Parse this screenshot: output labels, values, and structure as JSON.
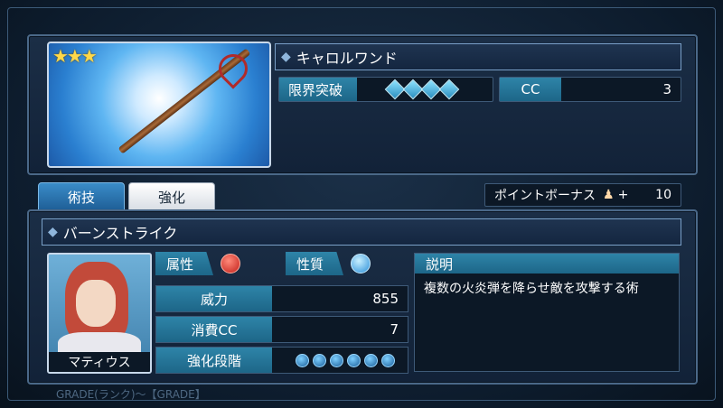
{
  "weapon": {
    "name": "キャロルワンド",
    "stars": "★★★",
    "limit_break_label": "限界突破",
    "limit_break_gems": 4,
    "cc_label": "CC",
    "cc_value": "3"
  },
  "tabs": [
    {
      "label": "術技",
      "active": true
    },
    {
      "label": "強化",
      "active": false
    }
  ],
  "point_bonus": {
    "label": "ポイントボーナス",
    "sign": "+",
    "value": "10"
  },
  "skill": {
    "name": "バーンストライク",
    "attribute_label": "属性",
    "nature_label": "性質",
    "power_label": "威力",
    "power_value": "855",
    "cost_label": "消費CC",
    "cost_value": "7",
    "enhance_label": "強化段階",
    "enhance_dots": 6,
    "description_label": "説明",
    "description": "複数の火炎弾を降らせ敵を攻撃する術"
  },
  "character": {
    "name": "マティウス"
  },
  "footer": "GRADE(ランク)～【GRADE】",
  "colors": {
    "accent": "#2e84a8",
    "fire_orb": "#d8322a",
    "nature_orb": "#3aa8e8"
  }
}
